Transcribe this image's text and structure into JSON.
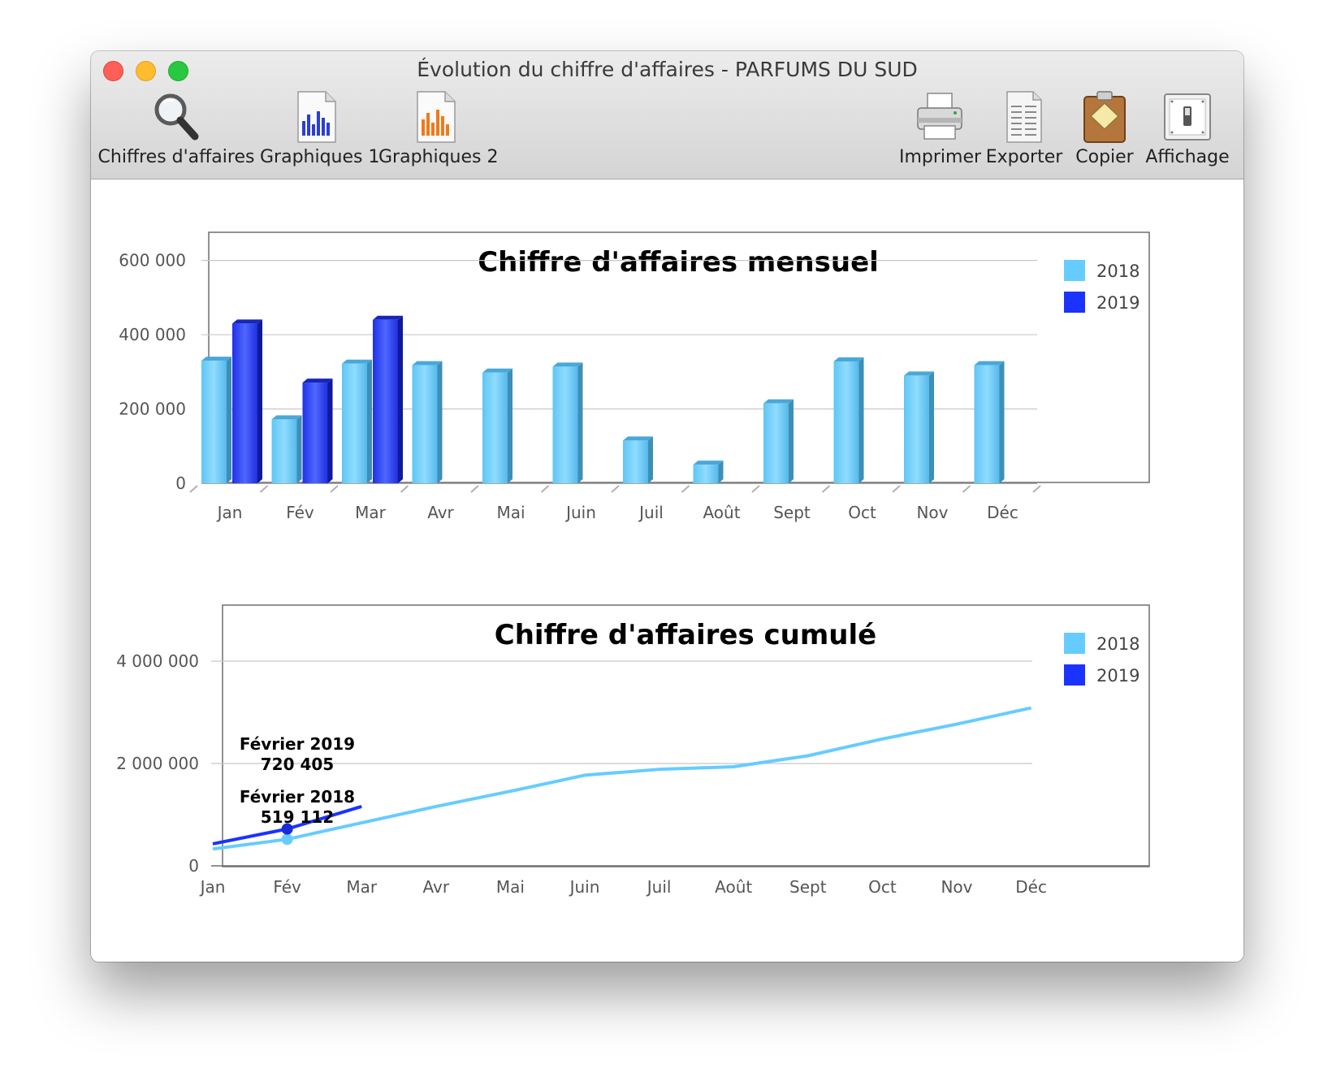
{
  "window": {
    "title": "Évolution du chiffre d'affaires - PARFUMS DU SUD"
  },
  "toolbar": {
    "left": [
      {
        "label": "Chiffres d'affaires",
        "icon": "magnifier-icon"
      },
      {
        "label": "Graphiques 1",
        "icon": "bar-chart-doc-icon"
      },
      {
        "label": "Graphiques 2",
        "icon": "orange-bar-chart-doc-icon"
      }
    ],
    "right": [
      {
        "label": "Imprimer",
        "icon": "printer-icon"
      },
      {
        "label": "Exporter",
        "icon": "export-document-icon"
      },
      {
        "label": "Copier",
        "icon": "clipboard-icon"
      },
      {
        "label": "Affichage",
        "icon": "switch-icon"
      }
    ]
  },
  "colors": {
    "series_2018": "#66ccff",
    "series_2019": "#1a33ff"
  },
  "chart_data": [
    {
      "type": "bar",
      "title": "Chiffre d'affaires mensuel",
      "categories": [
        "Jan",
        "Fév",
        "Mar",
        "Avr",
        "Mai",
        "Juin",
        "Juil",
        "Août",
        "Sept",
        "Oct",
        "Nov",
        "Déc"
      ],
      "series": [
        {
          "name": "2018",
          "values": [
            330000,
            172000,
            322000,
            318000,
            298000,
            314000,
            115000,
            50000,
            215000,
            328000,
            290000,
            318000
          ]
        },
        {
          "name": "2019",
          "values": [
            430000,
            271000,
            440000,
            null,
            null,
            null,
            null,
            null,
            null,
            null,
            null,
            null
          ]
        }
      ],
      "yticks": [
        "0",
        "200 000",
        "400 000",
        "600 000"
      ],
      "ytick_values": [
        0,
        200000,
        400000,
        600000
      ],
      "ylim": [
        0,
        750000
      ],
      "grid": true,
      "legend_position": "top-right"
    },
    {
      "type": "line",
      "title": "Chiffre d'affaires cumulé",
      "categories": [
        "Jan",
        "Fév",
        "Mar",
        "Avr",
        "Mai",
        "Juin",
        "Juil",
        "Août",
        "Sept",
        "Oct",
        "Nov",
        "Déc"
      ],
      "series": [
        {
          "name": "2018",
          "values": [
            330000,
            519112,
            841000,
            1159000,
            1457000,
            1771000,
            1886000,
            1936000,
            2151000,
            2479000,
            2769000,
            3087000
          ]
        },
        {
          "name": "2019",
          "values": [
            430000,
            720405,
            1160000,
            null,
            null,
            null,
            null,
            null,
            null,
            null,
            null,
            null
          ]
        }
      ],
      "yticks": [
        "0",
        "2 000 000",
        "4 000 000"
      ],
      "ytick_values": [
        0,
        2000000,
        4000000
      ],
      "ylim": [
        0,
        4800000
      ],
      "grid": true,
      "legend_position": "top-right",
      "annotations": [
        {
          "label": "Février 2019",
          "value": "720 405"
        },
        {
          "label": "Février 2018",
          "value": "519 112"
        }
      ]
    }
  ]
}
